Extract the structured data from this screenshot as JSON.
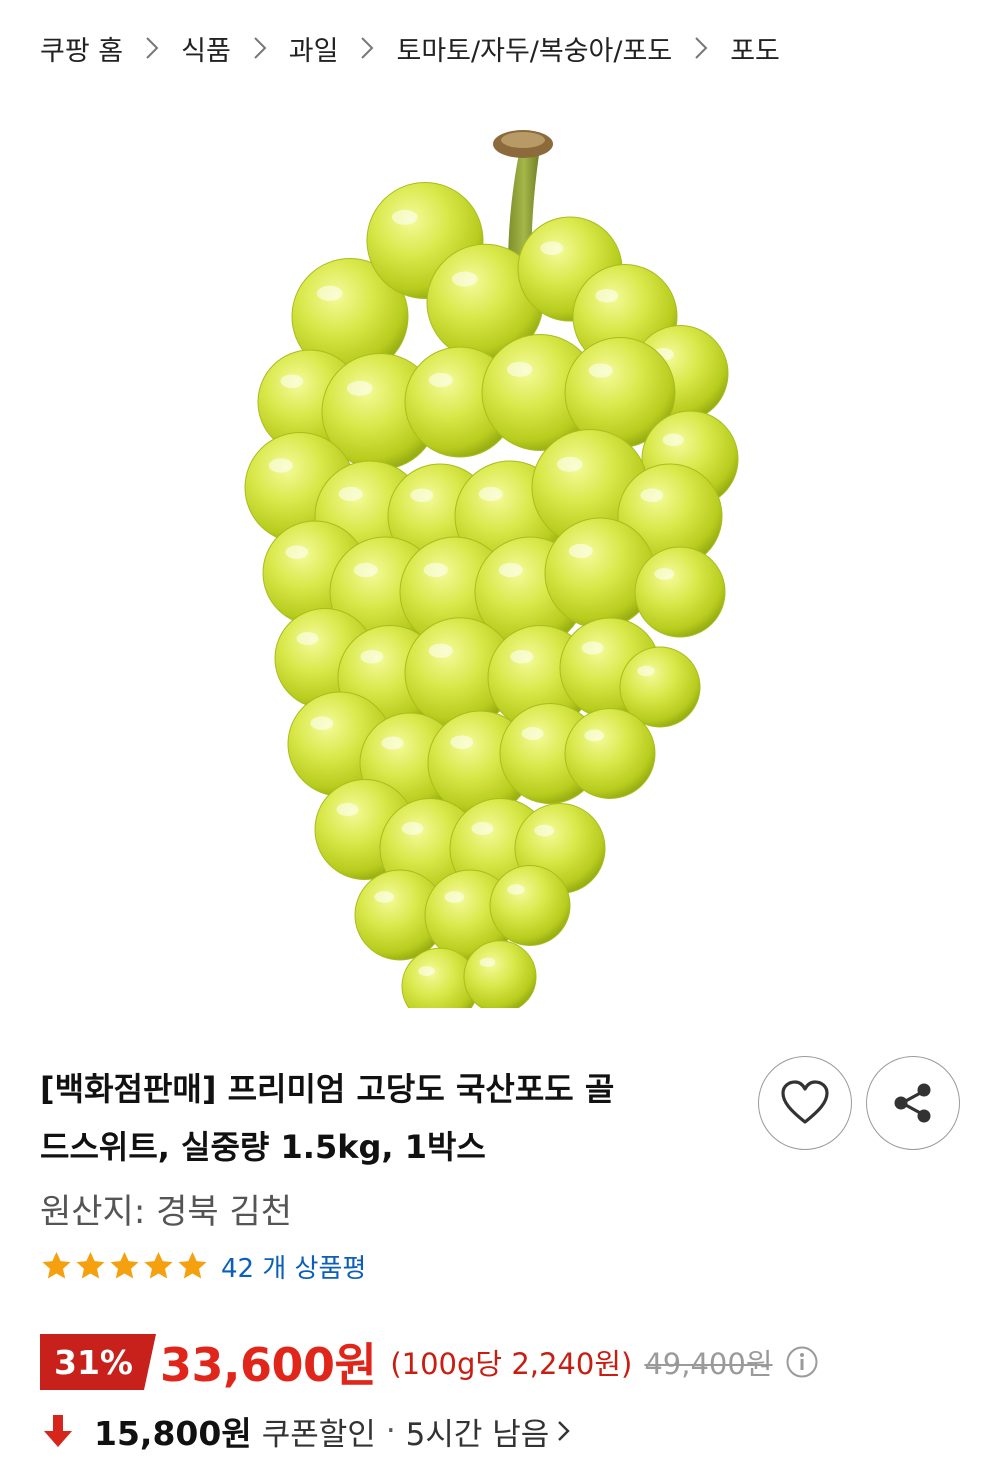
{
  "breadcrumb": [
    "쿠팡 홈",
    "식품",
    "과일",
    "토마토/자두/복숭아/포도",
    "포도"
  ],
  "product": {
    "title_line1": "[백화점판매] 프리미엄 고당도 국산포도 골",
    "title_line2": "드스위트, 실중량 1.5kg, 1박스",
    "origin": "원산지: 경북 김천",
    "rating": 5,
    "review_count": "42 개 상품평"
  },
  "price": {
    "discount": "31%",
    "sale": "33,600원",
    "unit": "(100g당 2,240원)",
    "original": "49,400원"
  },
  "coupon": {
    "price": "15,800원",
    "label": "쿠폰할인",
    "separator": "·",
    "time_left": "5시간 남음"
  },
  "icons": {
    "breadcrumb_sep": "chevron-right-icon",
    "wishlist": "heart-icon",
    "share": "share-icon",
    "rating": "star-icon",
    "info": "info-icon",
    "coupon": "arrow-down-icon",
    "more": "chevron-right-icon"
  },
  "colors": {
    "accent_red": "#e0261a",
    "badge_red": "#c8201a",
    "star": "#f5a00e",
    "link_blue": "#0b5fb8",
    "grape": "#cde03a"
  }
}
